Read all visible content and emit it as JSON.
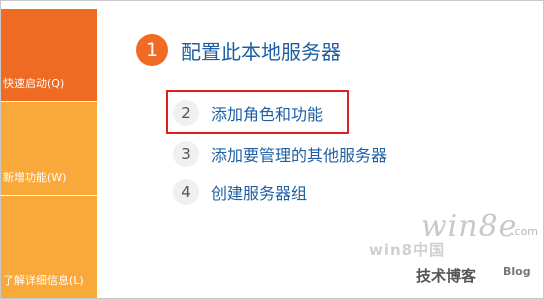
{
  "nav": {
    "quick_start": "快速启动(Q)",
    "whats_new": "新增功能(W)",
    "learn_more": "了解详细信息(L)"
  },
  "main": {
    "step1": {
      "number": "1",
      "label": "配置此本地服务器"
    },
    "step2": {
      "number": "2",
      "label": "添加角色和功能"
    },
    "step3": {
      "number": "3",
      "label": "添加要管理的其他服务器"
    },
    "step4": {
      "number": "4",
      "label": "创建服务器组"
    }
  },
  "watermark": {
    "brand": "win8e",
    "domain": ".com",
    "china": "win8中国",
    "tech": "技术博客",
    "blog": "Blog"
  },
  "colors": {
    "accent_orange": "#ef6a22",
    "tile_orange": "#f8a93a",
    "link_blue": "#1e5fa4",
    "highlight_red": "#e02020"
  }
}
